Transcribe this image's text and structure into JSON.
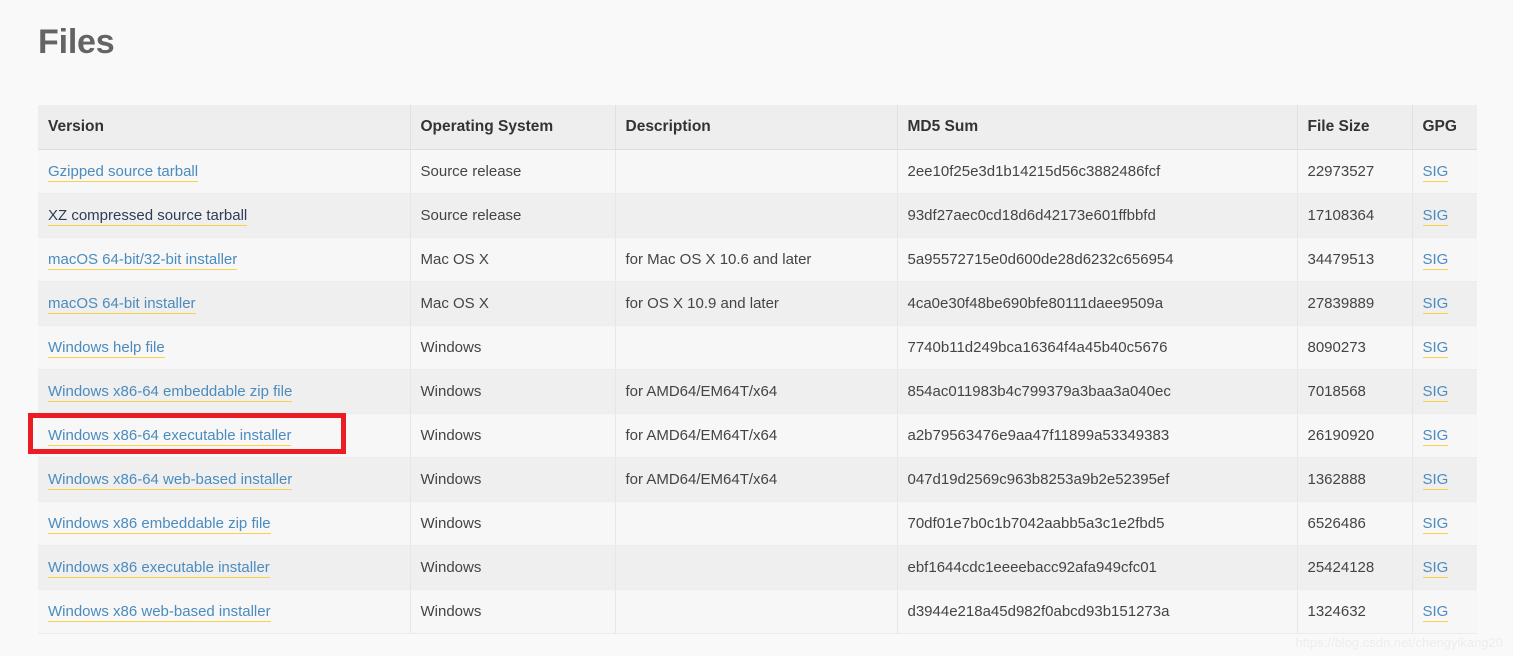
{
  "page": {
    "title": "Files",
    "watermark": "https://blog.csdn.net/chengyikang20"
  },
  "table": {
    "columns": [
      {
        "key": "version",
        "label": "Version"
      },
      {
        "key": "os",
        "label": "Operating System"
      },
      {
        "key": "desc",
        "label": "Description"
      },
      {
        "key": "md5",
        "label": "MD5 Sum"
      },
      {
        "key": "size",
        "label": "File Size"
      },
      {
        "key": "gpg",
        "label": "GPG"
      }
    ],
    "gpg_link_label": "SIG",
    "rows": [
      {
        "version": "Gzipped source tarball",
        "visited": false,
        "os": "Source release",
        "desc": "",
        "md5": "2ee10f25e3d1b14215d56c3882486fcf",
        "size": "22973527",
        "gpg": "SIG"
      },
      {
        "version": "XZ compressed source tarball",
        "visited": true,
        "os": "Source release",
        "desc": "",
        "md5": "93df27aec0cd18d6d42173e601ffbbfd",
        "size": "17108364",
        "gpg": "SIG"
      },
      {
        "version": "macOS 64-bit/32-bit installer",
        "visited": false,
        "os": "Mac OS X",
        "desc": "for Mac OS X 10.6 and later",
        "md5": "5a95572715e0d600de28d6232c656954",
        "size": "34479513",
        "gpg": "SIG"
      },
      {
        "version": "macOS 64-bit installer",
        "visited": false,
        "os": "Mac OS X",
        "desc": "for OS X 10.9 and later",
        "md5": "4ca0e30f48be690bfe80111daee9509a",
        "size": "27839889",
        "gpg": "SIG"
      },
      {
        "version": "Windows help file",
        "visited": false,
        "os": "Windows",
        "desc": "",
        "md5": "7740b11d249bca16364f4a45b40c5676",
        "size": "8090273",
        "gpg": "SIG"
      },
      {
        "version": "Windows x86-64 embeddable zip file",
        "visited": false,
        "os": "Windows",
        "desc": "for AMD64/EM64T/x64",
        "md5": "854ac011983b4c799379a3baa3a040ec",
        "size": "7018568",
        "gpg": "SIG"
      },
      {
        "version": "Windows x86-64 executable installer",
        "visited": false,
        "os": "Windows",
        "desc": "for AMD64/EM64T/x64",
        "md5": "a2b79563476e9aa47f11899a53349383",
        "size": "26190920",
        "gpg": "SIG",
        "highlighted": true
      },
      {
        "version": "Windows x86-64 web-based installer",
        "visited": false,
        "os": "Windows",
        "desc": "for AMD64/EM64T/x64",
        "md5": "047d19d2569c963b8253a9b2e52395ef",
        "size": "1362888",
        "gpg": "SIG"
      },
      {
        "version": "Windows x86 embeddable zip file",
        "visited": false,
        "os": "Windows",
        "desc": "",
        "md5": "70df01e7b0c1b7042aabb5a3c1e2fbd5",
        "size": "6526486",
        "gpg": "SIG"
      },
      {
        "version": "Windows x86 executable installer",
        "visited": false,
        "os": "Windows",
        "desc": "",
        "md5": "ebf1644cdc1eeeebacc92afa949cfc01",
        "size": "25424128",
        "gpg": "SIG"
      },
      {
        "version": "Windows x86 web-based installer",
        "visited": false,
        "os": "Windows",
        "desc": "",
        "md5": "d3944e218a45d982f0abcd93b151273a",
        "size": "1324632",
        "gpg": "SIG"
      }
    ]
  },
  "colors": {
    "link": "#4b8bbe",
    "link_visited": "#2c3e56",
    "link_underline": "#f7d14a",
    "highlight_box": "#eb1c24",
    "header_bg": "#eeeeee",
    "page_bg": "#f9f9f9"
  }
}
